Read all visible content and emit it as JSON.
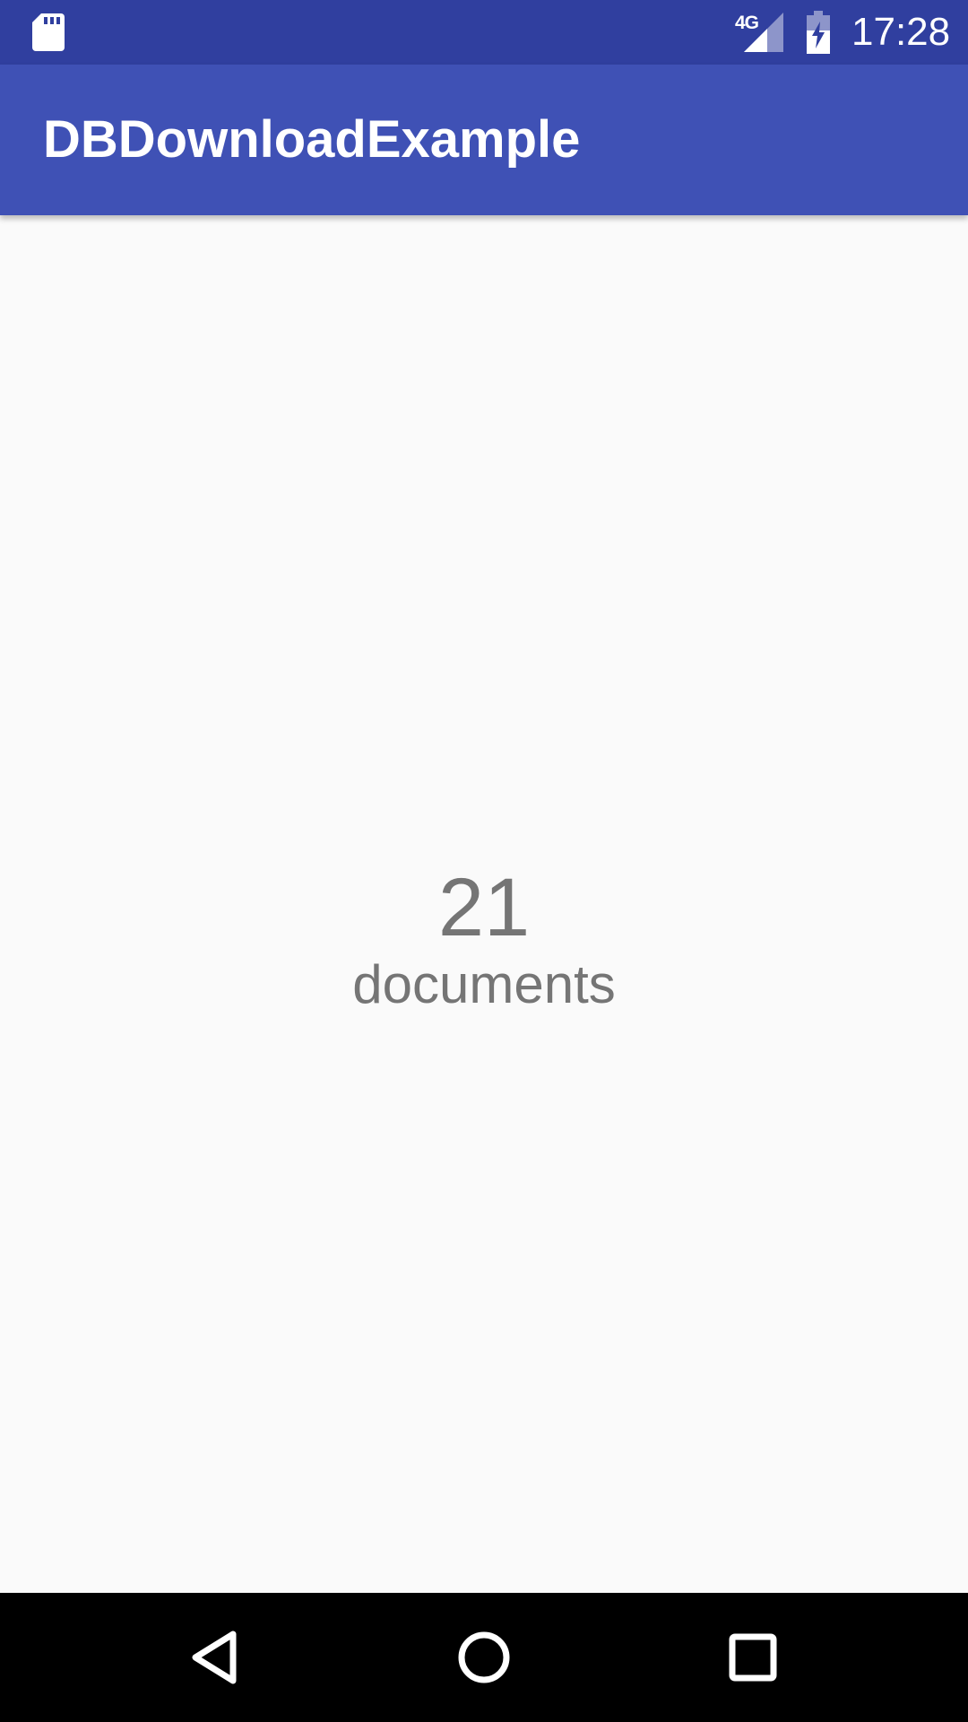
{
  "status_bar": {
    "left_icon": "sd-card-icon",
    "network_type": "4G",
    "signal_icon": "cell-signal-icon",
    "battery_icon": "battery-charging-icon",
    "time": "17:28",
    "background_color": "#303f9f"
  },
  "app_bar": {
    "title": "DBDownloadExample",
    "background_color": "#3f51b5"
  },
  "main": {
    "count": "21",
    "unit_label": "documents",
    "text_color": "#757575",
    "background_color": "#fafafa"
  },
  "nav_bar": {
    "buttons": [
      {
        "icon": "back-icon"
      },
      {
        "icon": "home-icon"
      },
      {
        "icon": "recents-icon"
      }
    ],
    "background_color": "#000000"
  }
}
